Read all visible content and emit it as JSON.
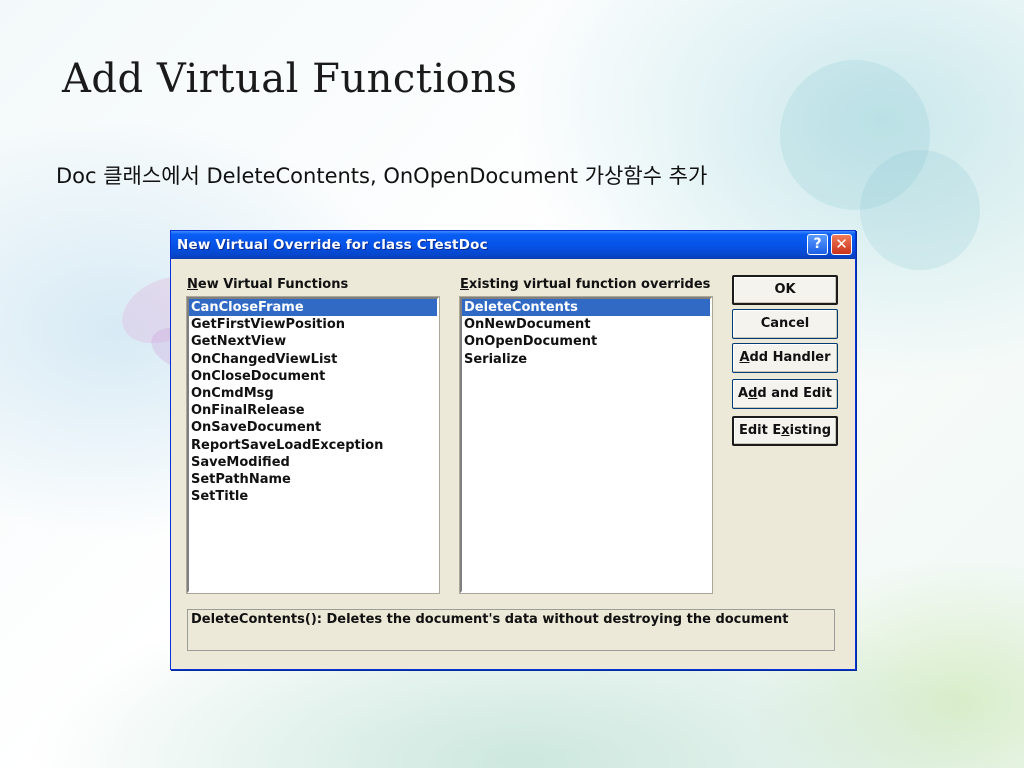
{
  "slide": {
    "title": "Add Virtual Functions",
    "subtitle": "Doc 클래스에서 DeleteContents, OnOpenDocument 가상함수 추가"
  },
  "dialog": {
    "title": "New Virtual Override for class CTestDoc",
    "help_icon": "help-icon",
    "close_icon": "close-icon",
    "new_label": "New Virtual Functions",
    "existing_label": "Existing virtual function overrides",
    "new_functions": [
      "CanCloseFrame",
      "GetFirstViewPosition",
      "GetNextView",
      "OnChangedViewList",
      "OnCloseDocument",
      "OnCmdMsg",
      "OnFinalRelease",
      "OnSaveDocument",
      "ReportSaveLoadException",
      "SaveModified",
      "SetPathName",
      "SetTitle"
    ],
    "new_selected": "CanCloseFrame",
    "existing_functions": [
      "DeleteContents",
      "OnNewDocument",
      "OnOpenDocument",
      "Serialize"
    ],
    "existing_selected": "DeleteContents",
    "buttons": {
      "ok": "OK",
      "cancel": "Cancel",
      "add_handler": "Add Handler",
      "add_and_edit": "Add and Edit",
      "edit_existing": "Edit Existing"
    },
    "description": "DeleteContents():  Deletes the document's data without destroying the document"
  }
}
